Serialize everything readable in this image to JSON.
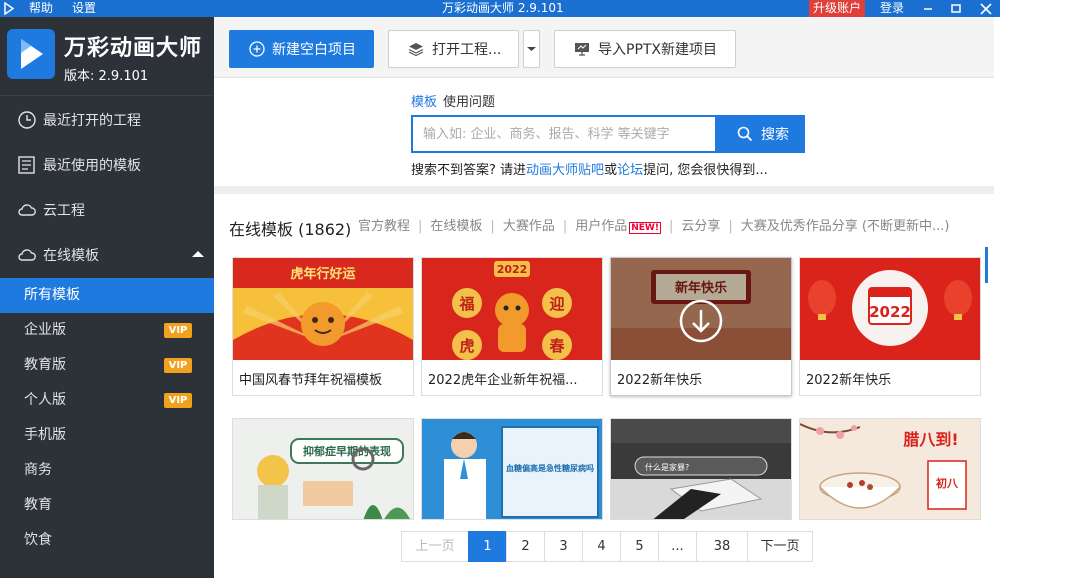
{
  "titlebar": {
    "help": "帮助",
    "settings": "设置",
    "title": "万彩动画大师 2.9.101",
    "upgrade": "升级账户",
    "login": "登录"
  },
  "sidebar": {
    "brand_title": "万彩动画大师",
    "brand_version": "版本: 2.9.101",
    "main_items": [
      {
        "label": "最近打开的工程",
        "icon": "clock-icon"
      },
      {
        "label": "最近使用的模板",
        "icon": "template-icon"
      },
      {
        "label": "云工程",
        "icon": "cloud-icon"
      },
      {
        "label": "在线模板",
        "icon": "cloud-icon"
      }
    ],
    "sub_items": [
      {
        "label": "所有模板",
        "active": true
      },
      {
        "label": "企业版",
        "vip": "VIP"
      },
      {
        "label": "教育版",
        "vip": "VIP"
      },
      {
        "label": "个人版",
        "vip": "VIP"
      },
      {
        "label": "手机版"
      },
      {
        "label": "商务"
      },
      {
        "label": "教育"
      },
      {
        "label": "饮食"
      }
    ]
  },
  "toolbar": {
    "new_blank": "新建空白项目",
    "open_project": "打开工程...",
    "import_pptx": "导入PPTX新建项目"
  },
  "search": {
    "tab_templates": "模板",
    "tab_questions": "使用问题",
    "placeholder": "输入如: 企业、商务、报告、科学 等关键字",
    "button": "搜索",
    "hint_prefix": "搜索不到答案? 请进",
    "hint_link1": "动画大师贴吧",
    "hint_or": "或",
    "hint_link2": "论坛",
    "hint_suffix": "提问, 您会很快得到..."
  },
  "catalog": {
    "title": "在线模板 (1862)",
    "tabs": [
      "官方教程",
      "在线模板",
      "大赛作品",
      "用户作品",
      "云分享",
      "大赛及优秀作品分享 (不断更新中...)"
    ],
    "new_badge": "NEW!"
  },
  "cards": [
    {
      "caption": "中国风春节拜年祝福模板",
      "banner": "虎年行好运"
    },
    {
      "caption": "2022虎年企业新年祝福...",
      "year": "2022",
      "chars": [
        "福",
        "迎",
        "虎",
        "春"
      ]
    },
    {
      "caption": "2022新年快乐",
      "banner": "新年快乐"
    },
    {
      "caption": "2022新年快乐",
      "year": "2022"
    }
  ],
  "cards_row2": [
    {
      "text": "抑郁症早期的表现"
    },
    {
      "text": "血糖偏高是急性糖尿病吗"
    },
    {
      "text": "什么是家暴?"
    },
    {
      "text": "腊八到!",
      "sub": "初八"
    }
  ],
  "pager": {
    "prev": "上一页",
    "pages": [
      "1",
      "2",
      "3",
      "4",
      "5",
      "...",
      "38"
    ],
    "next": "下一页",
    "current": "1"
  },
  "colors": {
    "accent": "#1f7ae0",
    "sidebar_bg": "#2d3138",
    "vip": "#f0a21e",
    "upgrade": "#e0403a"
  }
}
